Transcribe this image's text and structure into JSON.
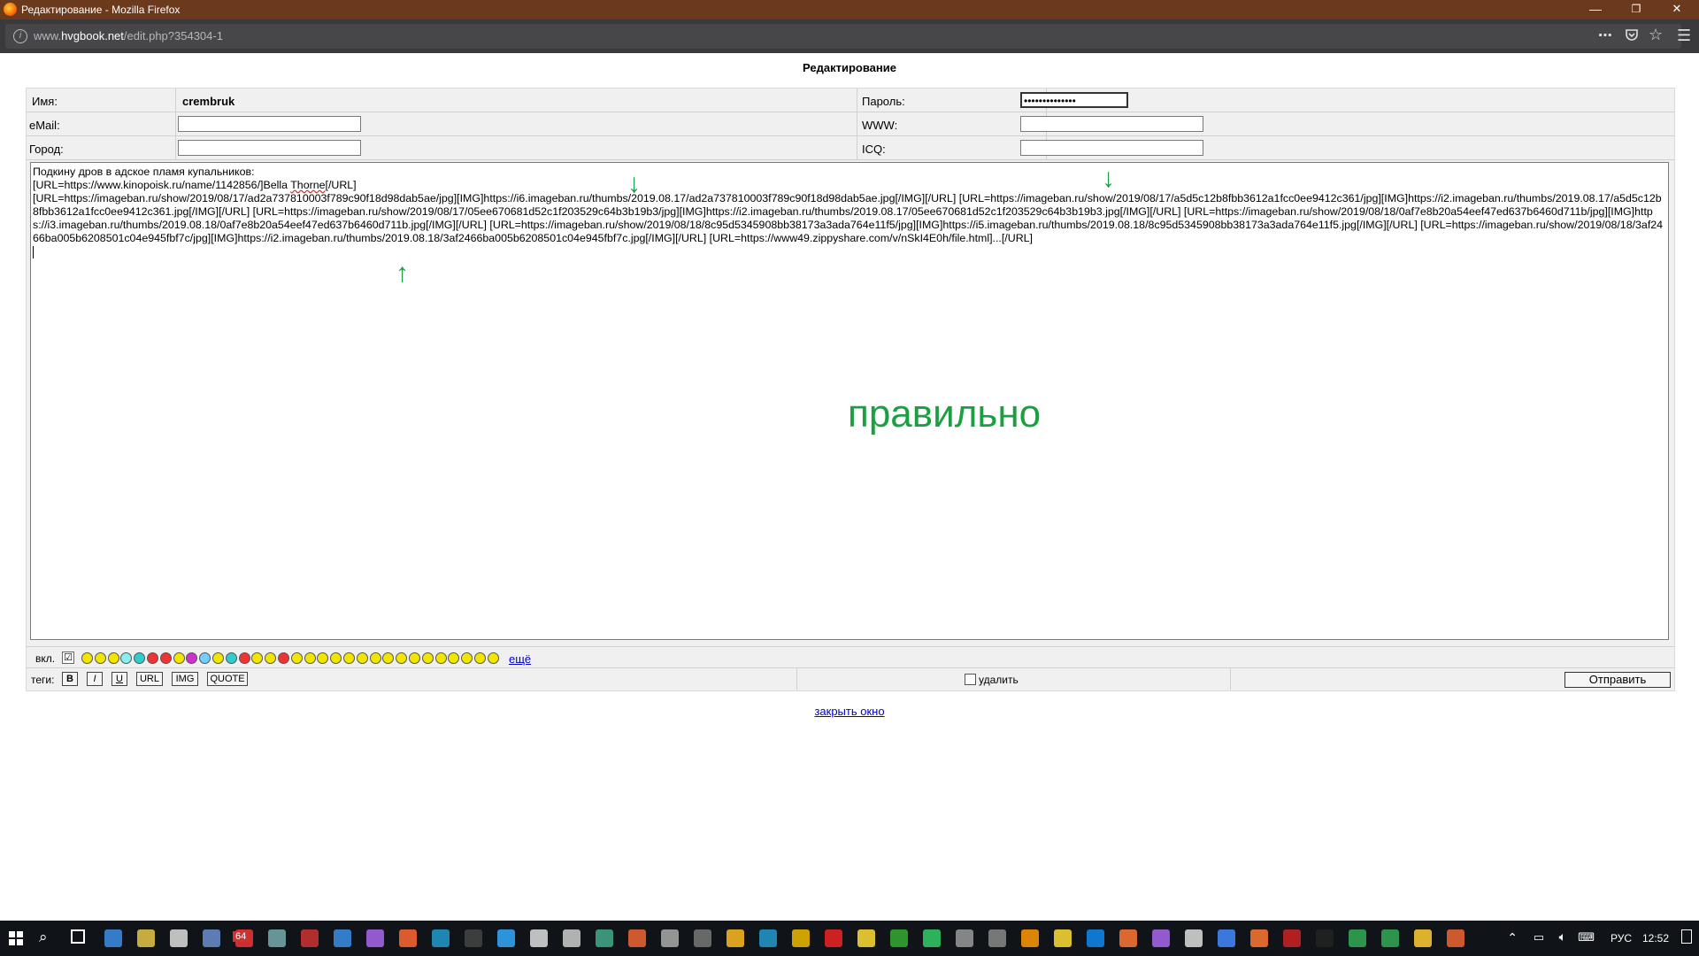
{
  "window": {
    "title": "Редактирование - Mozilla Firefox",
    "minimize": "—",
    "restore": "❐",
    "close": "✕"
  },
  "address_bar": {
    "url_prefix": "www.",
    "url_domain": "hvgbook.net",
    "url_path": "/edit.php?354304-1"
  },
  "page": {
    "title": "Редактирование",
    "fields": {
      "name_label": "Имя:",
      "name_value": "crembruk",
      "password_label": "Пароль:",
      "password_value": "••••••••••••••",
      "email_label": "eMail:",
      "www_label": "WWW:",
      "city_label": "Город:",
      "icq_label": "ICQ:"
    },
    "message": {
      "line1": "Подкину дров в адское пламя купальников:",
      "line2_pre": "[URL=https://www.kinopoisk.ru/name/1142856/]Bella ",
      "line2_word": "Thorne",
      "line2_post": "[/URL]",
      "body": "[URL=https://imageban.ru/show/2019/08/17/ad2a737810003f789c90f18d98dab5ae/jpg][IMG]https://i6.imageban.ru/thumbs/2019.08.17/ad2a737810003f789c90f18d98dab5ae.jpg[/IMG][/URL] [URL=https://imageban.ru/show/2019/08/17/a5d5c12b8fbb3612a1fcc0ee9412c361/jpg][IMG]https://i2.imageban.ru/thumbs/2019.08.17/a5d5c12b8fbb3612a1fcc0ee9412c361.jpg[/IMG][/URL] [URL=https://imageban.ru/show/2019/08/17/05ee670681d52c1f203529c64b3b19b3/jpg][IMG]https://i2.imageban.ru/thumbs/2019.08.17/05ee670681d52c1f203529c64b3b19b3.jpg[/IMG][/URL] [URL=https://imageban.ru/show/2019/08/18/0af7e8b20a54eef47ed637b6460d711b/jpg][IMG]https://i3.imageban.ru/thumbs/2019.08.18/0af7e8b20a54eef47ed637b6460d711b.jpg[/IMG][/URL] [URL=https://imageban.ru/show/2019/08/18/8c95d5345908bb38173a3ada764e11f5/jpg][IMG]https://i5.imageban.ru/thumbs/2019.08.18/8c95d5345908bb38173a3ada764e11f5.jpg[/IMG][/URL] [URL=https://imageban.ru/show/2019/08/18/3af2466ba005b6208501c04e945fbf7c/jpg][IMG]https://i2.imageban.ru/thumbs/2019.08.18/3af2466ba005b6208501c04e945fbf7c.jpg[/IMG][/URL] [URL=https://www49.zippyshare.com/v/nSkI4E0h/file.html]...[/URL]"
    },
    "annotation": "правильно",
    "arrow_glyph_down": "↓",
    "arrow_glyph_up": "↑",
    "smilies": {
      "enabled_label": "вкл.",
      "checkbox_mark": "☑",
      "more_link": "ещё",
      "colors": [
        "#f2e600",
        "#f2e600",
        "#f2e600",
        "#8ee",
        "#3cc",
        "#e33",
        "#e33",
        "#f2e600",
        "#c3c",
        "#7cf",
        "#f2e600",
        "#3cc",
        "#e33",
        "#f2e600",
        "#f2e600",
        "#e33",
        "#f2e600",
        "#f2e600",
        "#f2e600",
        "#f2e600",
        "#f2e600",
        "#f2e600",
        "#f2e600",
        "#f2e600",
        "#f2e600",
        "#f2e600",
        "#f2e600",
        "#f2e600",
        "#f2e600",
        "#f2e600",
        "#f2e600",
        "#f2e600"
      ]
    },
    "tags": {
      "label": "теги:",
      "bold": "B",
      "italic": "I",
      "underline": "U",
      "url": "URL",
      "img": "IMG",
      "quote": "QUOTE",
      "delete_label": "удалить",
      "submit": "Отправить"
    },
    "close_link": "закрыть окно"
  },
  "taskbar": {
    "badge": "64",
    "language": "РУС",
    "time": "12:52"
  }
}
